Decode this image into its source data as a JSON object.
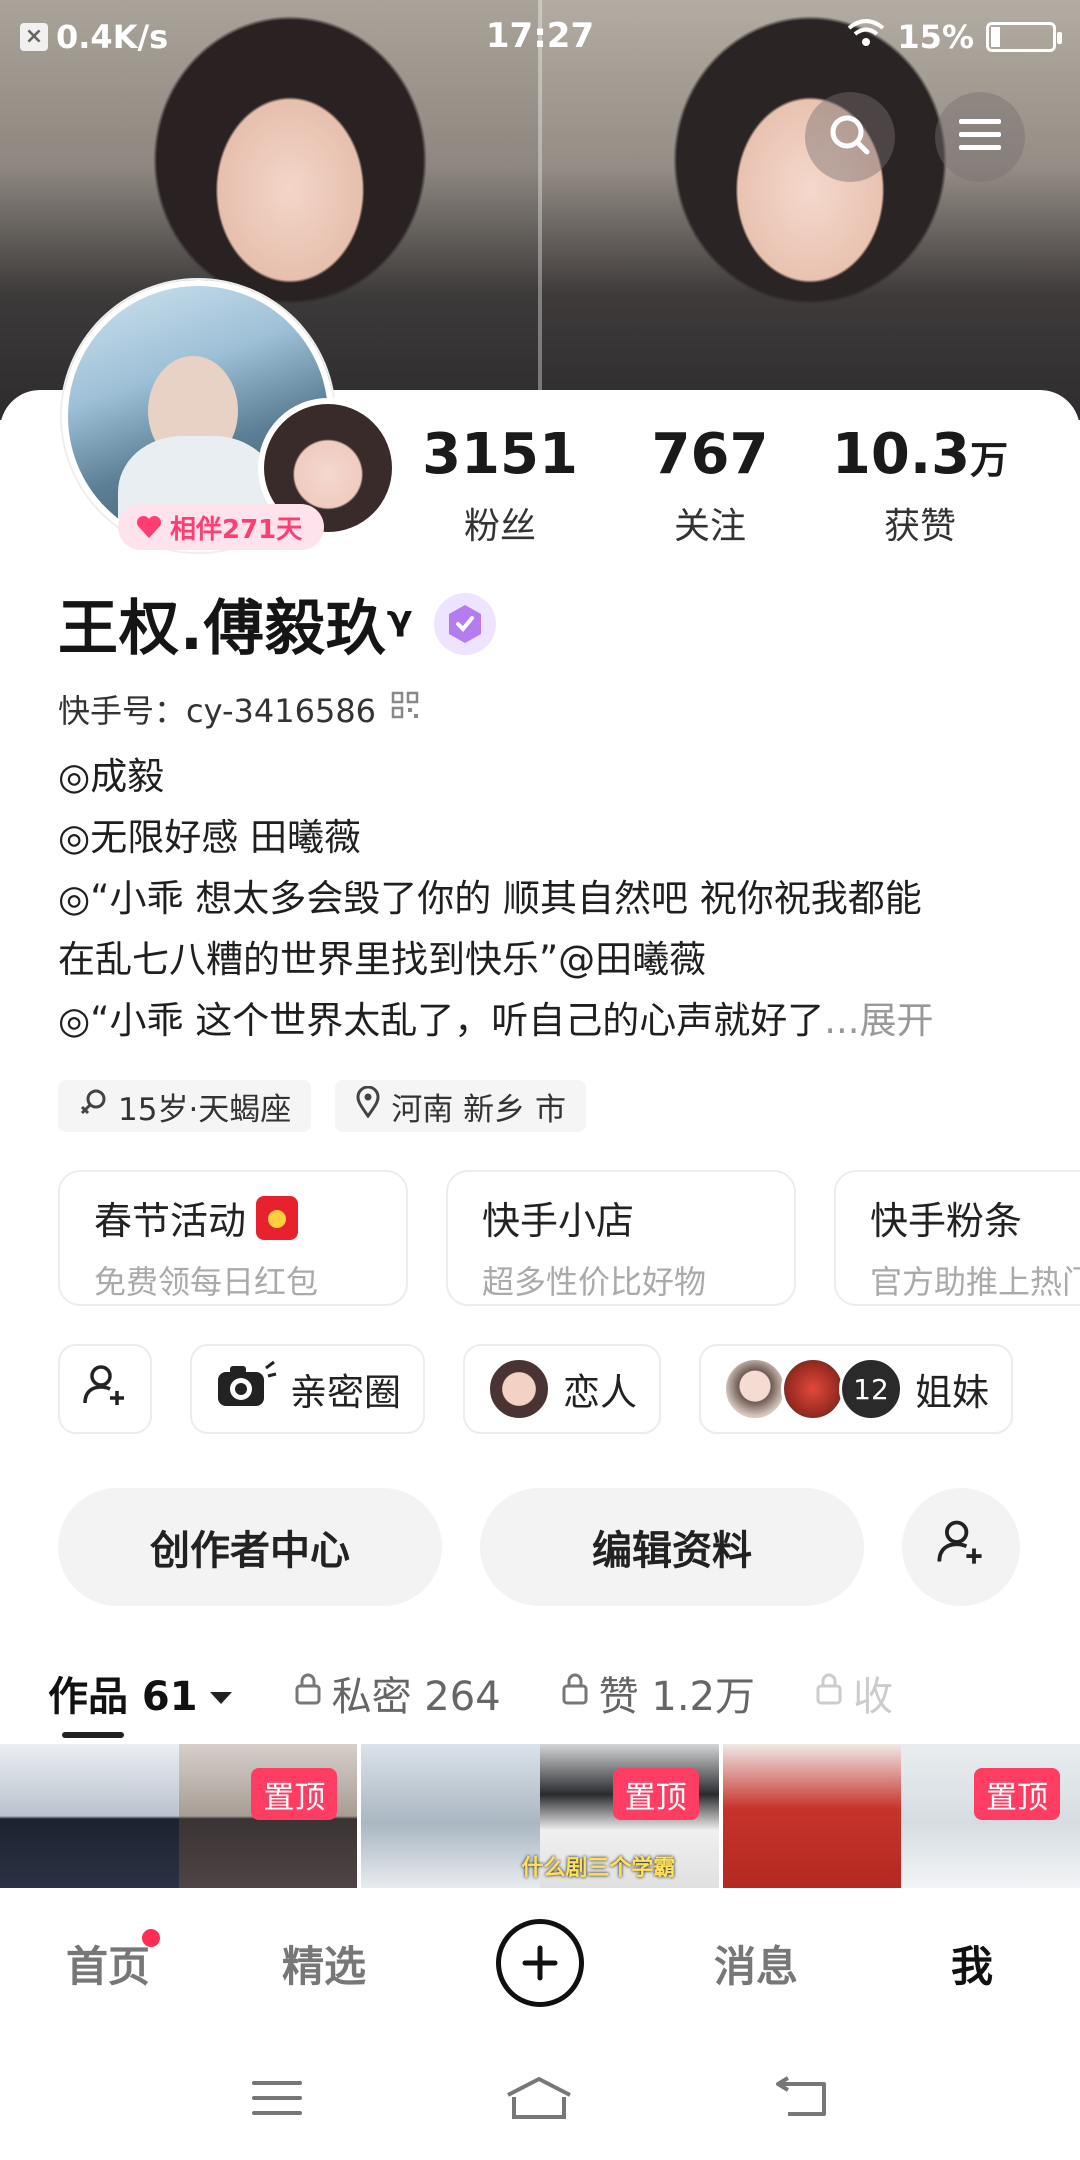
{
  "status_bar": {
    "network_speed": "0.4K/s",
    "time": "17:27",
    "battery": "15%",
    "battery_level": 0.15
  },
  "header": {
    "search_icon": "search-icon",
    "menu_icon": "menu-icon"
  },
  "profile": {
    "companion_badge": "相伴271天",
    "name": "王权.傅毅玖ᵞ",
    "kuaishou_id": "快手号：cy-3416586",
    "stats": [
      {
        "value": "3151",
        "unit": "",
        "label": "粉丝"
      },
      {
        "value": "767",
        "unit": "",
        "label": "关注"
      },
      {
        "value": "10.3",
        "unit": "万",
        "label": "获赞"
      }
    ],
    "bio": [
      "◎成毅",
      "◎无限好感  田曦薇",
      "◎“小乖 想太多会毁了你的 顺其自然吧 祝你祝我都能",
      "在乱七八糟的世界里找到快乐”@田曦薇",
      "◎“小乖 这个世界太乱了，听自己的心声就好了"
    ],
    "bio_expand": "...展开",
    "tags": {
      "age": "15岁·天蝎座",
      "location": "河南 新乡 市"
    }
  },
  "features": [
    {
      "title": "春节活动",
      "subtitle": "免费领每日红包"
    },
    {
      "title": "快手小店",
      "subtitle": "超多性价比好物"
    },
    {
      "title": "快手粉条",
      "subtitle": "官方助推上热门"
    }
  ],
  "relations": {
    "intimate_circle": "亲密圈",
    "lover": "恋人",
    "sisters_count": "12",
    "sisters": "姐妹"
  },
  "actions": {
    "creator_center": "创作者中心",
    "edit_profile": "编辑资料"
  },
  "tabs": {
    "works": "作品 61",
    "private": "私密 264",
    "likes": "赞 1.2万",
    "favorites": "收"
  },
  "thumbnails": {
    "pin_label": "置顶",
    "caption": "什么剧三个学霸"
  },
  "bottom_nav": {
    "home": "首页",
    "featured": "精选",
    "messages": "消息",
    "me": "我"
  }
}
